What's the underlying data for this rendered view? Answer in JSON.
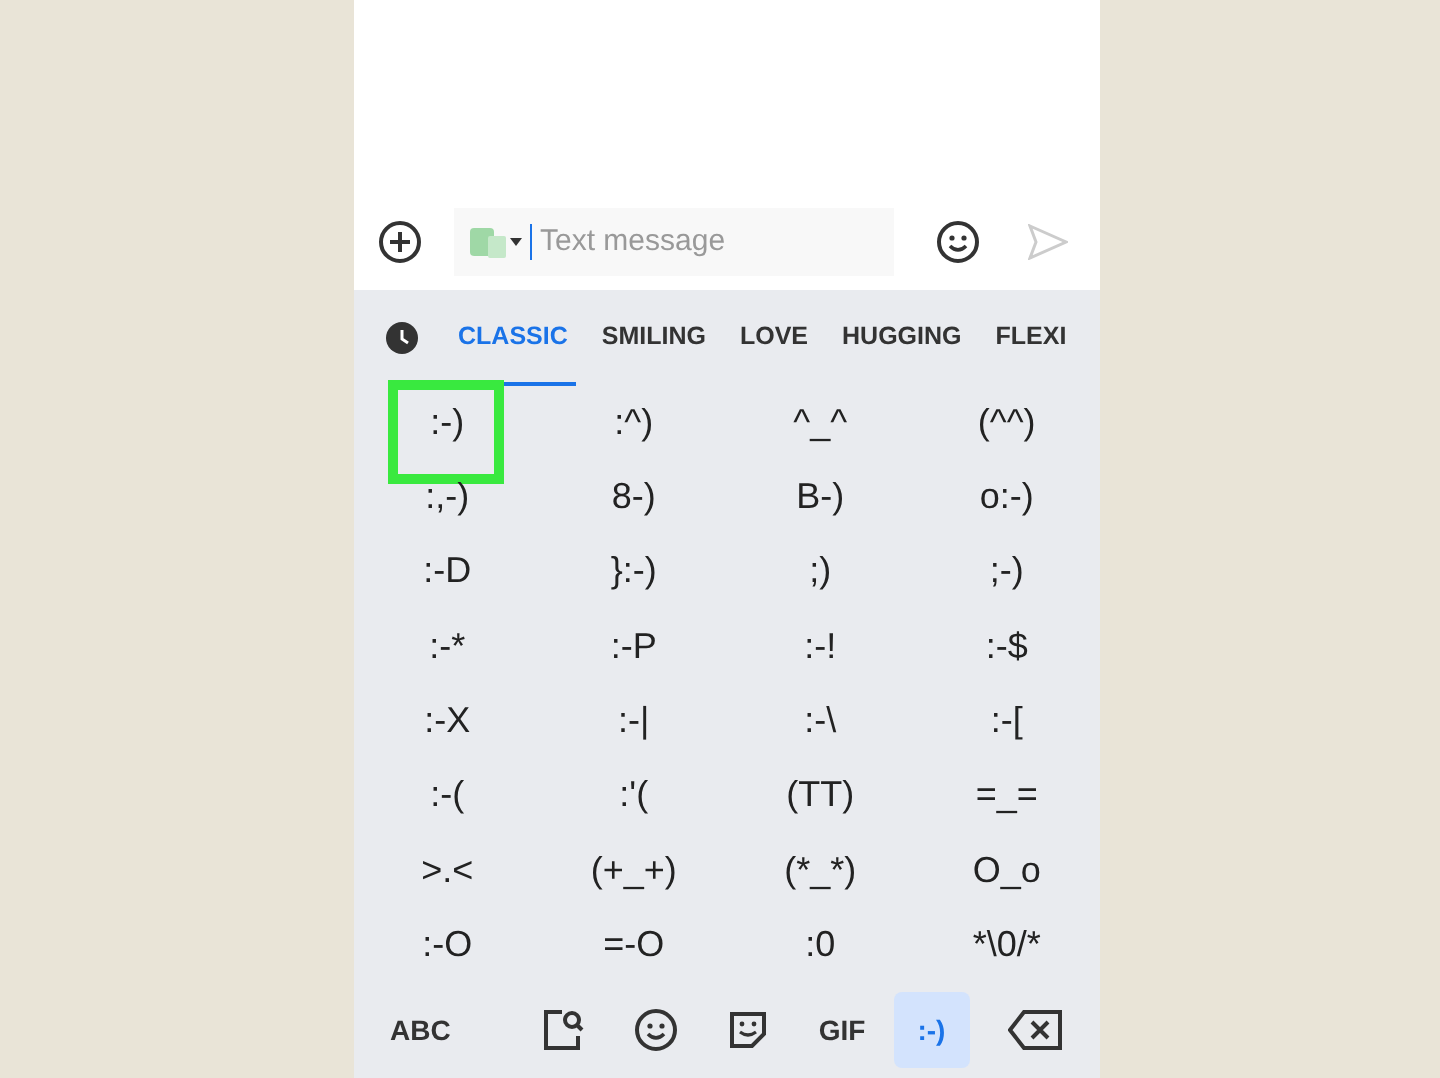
{
  "composer": {
    "placeholder": "Text message"
  },
  "tabs": [
    {
      "label": "CLASSIC",
      "selected": true
    },
    {
      "label": "SMILING",
      "selected": false
    },
    {
      "label": "LOVE",
      "selected": false
    },
    {
      "label": "HUGGING",
      "selected": false
    },
    {
      "label": "FLEXI",
      "selected": false
    }
  ],
  "emoticons": [
    {
      "text": ":-)",
      "highlighted": true
    },
    {
      "text": ":^)",
      "highlighted": false
    },
    {
      "text": "^_^",
      "highlighted": false
    },
    {
      "text": "(^^)",
      "highlighted": false
    },
    {
      "text": ":,-)",
      "highlighted": false
    },
    {
      "text": "8-)",
      "highlighted": false
    },
    {
      "text": "B-)",
      "highlighted": false
    },
    {
      "text": "o:-)",
      "highlighted": false
    },
    {
      "text": ":-D",
      "highlighted": false
    },
    {
      "text": "}:-)",
      "highlighted": false
    },
    {
      "text": ";)",
      "highlighted": false
    },
    {
      "text": ";-)",
      "highlighted": false
    },
    {
      "text": ":-*",
      "highlighted": false
    },
    {
      "text": ":-P",
      "highlighted": false
    },
    {
      "text": ":-!",
      "highlighted": false
    },
    {
      "text": ":-$",
      "highlighted": false
    },
    {
      "text": ":-X",
      "highlighted": false
    },
    {
      "text": ":-|",
      "highlighted": false
    },
    {
      "text": ":-\\",
      "highlighted": false
    },
    {
      "text": ":-[",
      "highlighted": false
    },
    {
      "text": ":-(",
      "highlighted": false
    },
    {
      "text": ":'(",
      "highlighted": false
    },
    {
      "text": "(TT)",
      "highlighted": false
    },
    {
      "text": "=_=",
      "highlighted": false
    },
    {
      "text": ">.<",
      "highlighted": false
    },
    {
      "text": "(+_+)",
      "highlighted": false
    },
    {
      "text": "(*_*)",
      "highlighted": false
    },
    {
      "text": "O_o",
      "highlighted": false
    },
    {
      "text": ":-O",
      "highlighted": false
    },
    {
      "text": "=-O",
      "highlighted": false
    },
    {
      "text": ":0",
      "highlighted": false
    },
    {
      "text": "*\\0/*",
      "highlighted": false
    }
  ],
  "bottom_bar": [
    {
      "kind": "text",
      "label": "ABC",
      "selected": false
    },
    {
      "kind": "sticker-search",
      "selected": false
    },
    {
      "kind": "emoji",
      "selected": false
    },
    {
      "kind": "sticker",
      "selected": false
    },
    {
      "kind": "text",
      "label": "GIF",
      "selected": false
    },
    {
      "kind": "text",
      "label": ":-)",
      "selected": true
    },
    {
      "kind": "backspace",
      "selected": false
    }
  ]
}
